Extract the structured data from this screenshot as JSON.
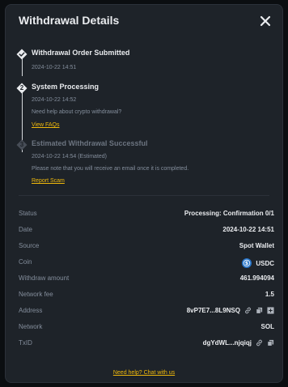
{
  "header": {
    "title": "Withdrawal Details"
  },
  "steps": [
    {
      "badge": "",
      "title": "Withdrawal Order Submitted",
      "time": "2024-10-22 14:51"
    },
    {
      "badge": "2",
      "title": "System Processing",
      "time": "2024-10-22 14:52",
      "note": "Need help about crypto withdrawal?",
      "link": "View FAQs"
    },
    {
      "badge": "3",
      "title": "Estimated Withdrawal Successful",
      "time": "2024-10-22 14:54 (Estimated)",
      "note": "Please note that you will receive an email once it is completed.",
      "link": "Report Scam"
    }
  ],
  "details": {
    "status": {
      "label": "Status",
      "value": "Processing: Confirmation 0/1"
    },
    "date": {
      "label": "Date",
      "value": "2024-10-22 14:51"
    },
    "source": {
      "label": "Source",
      "value": "Spot Wallet"
    },
    "coin": {
      "label": "Coin",
      "value": "USDC"
    },
    "amount": {
      "label": "Withdraw amount",
      "value": "461.994094"
    },
    "fee": {
      "label": "Network fee",
      "value": "1.5"
    },
    "address": {
      "label": "Address",
      "value": "8vP7E7...8L9NSQ"
    },
    "network": {
      "label": "Network",
      "value": "SOL"
    },
    "txid": {
      "label": "TxID",
      "value": "dgYdWL...njqiqj"
    }
  },
  "footer": {
    "help_link": "Need help? Chat with us"
  },
  "colors": {
    "accent": "#f0b90b",
    "panel": "#1e2329",
    "coin": "#2775ca"
  }
}
